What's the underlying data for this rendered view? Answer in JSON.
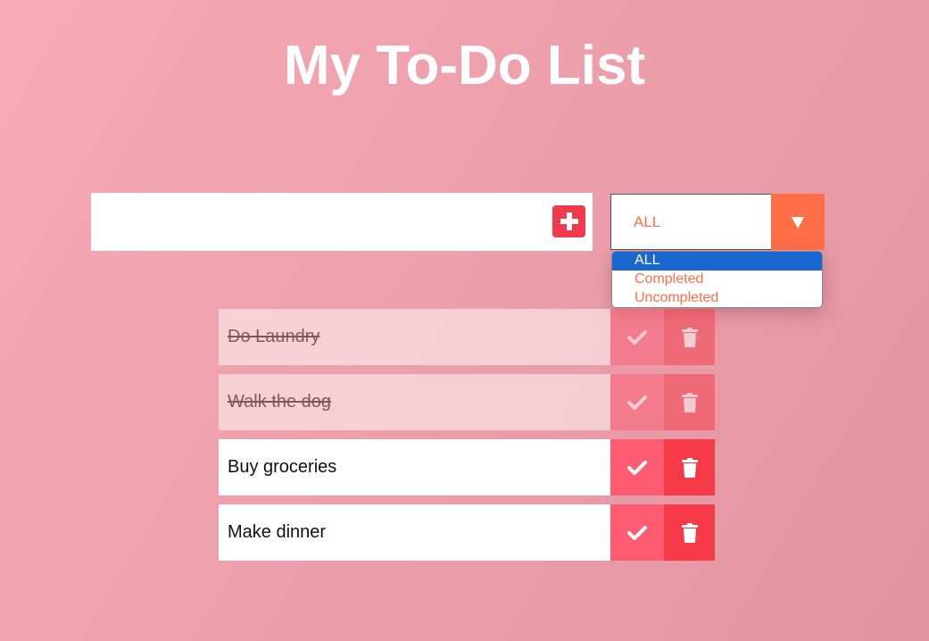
{
  "header": {
    "title": "My To-Do List"
  },
  "input": {
    "value": "",
    "placeholder": ""
  },
  "add_button": {
    "icon": "plus-icon"
  },
  "filter": {
    "selected": "ALL",
    "options": [
      "ALL",
      "Completed",
      "Uncompleted"
    ],
    "accent": "#ff6f47",
    "highlight": "#1a67d2"
  },
  "todos": [
    {
      "text": "Do Laundry",
      "completed": true
    },
    {
      "text": "Walk the dog",
      "completed": true
    },
    {
      "text": "Buy groceries",
      "completed": false
    },
    {
      "text": "Make dinner",
      "completed": false
    }
  ],
  "colors": {
    "check": "#ff5c73",
    "trash": "#f73a48",
    "add": "#f13a4d"
  }
}
